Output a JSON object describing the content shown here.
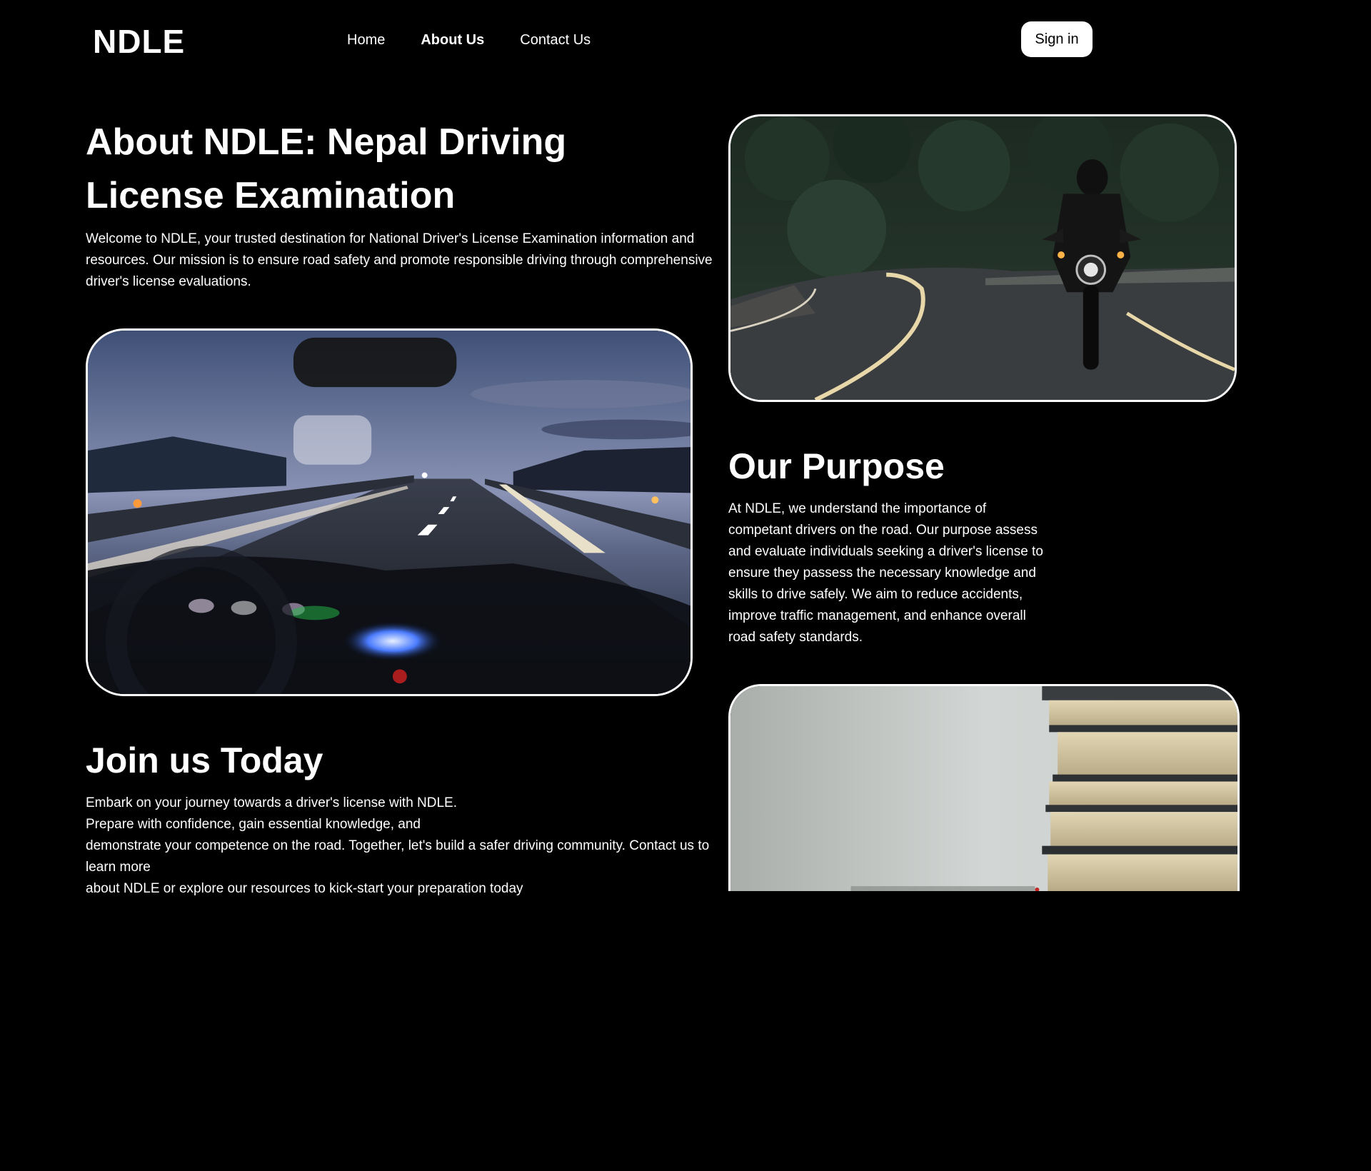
{
  "header": {
    "logo": "NDLE",
    "nav": [
      {
        "label": "Home"
      },
      {
        "label": "About Us"
      },
      {
        "label": "Contact Us"
      }
    ],
    "signin_label": "Sign in"
  },
  "about": {
    "title": "About NDLE: Nepal Driving License Examination",
    "text": "Welcome to NDLE, your trusted destination for National Driver's License Examination information and resources. Our mission is to ensure road safety and promote responsible driving through comprehensive driver's license evaluations."
  },
  "purpose": {
    "title": "Our Purpose",
    "text": "At NDLE, we understand the importance of competant drivers on the road. Our purpose assess and evaluate individuals seeking a driver's license to ensure they passess the necessary knowledge and skills to drive safely. We aim to reduce accidents, improve traffic management, and enhance overall road safety standards."
  },
  "join": {
    "title": "Join us Today",
    "lines": [
      "Embark on your journey towards a driver's license with NDLE.",
      "Prepare with confidence, gain essential knowledge, and",
      "demonstrate your competence on the road. Together, let's build a safer driving community. Contact us to learn more",
      "about NDLE or explore our resources to kick-start your preparation today"
    ]
  },
  "images": {
    "road": "highway-windshield-photo",
    "motorcycle": "motorcyclist-road-photo",
    "books": "stacked-books-photo"
  },
  "colors": {
    "background": "#000000",
    "text": "#ffffff",
    "button_bg": "#ffffff",
    "button_text": "#000000"
  }
}
